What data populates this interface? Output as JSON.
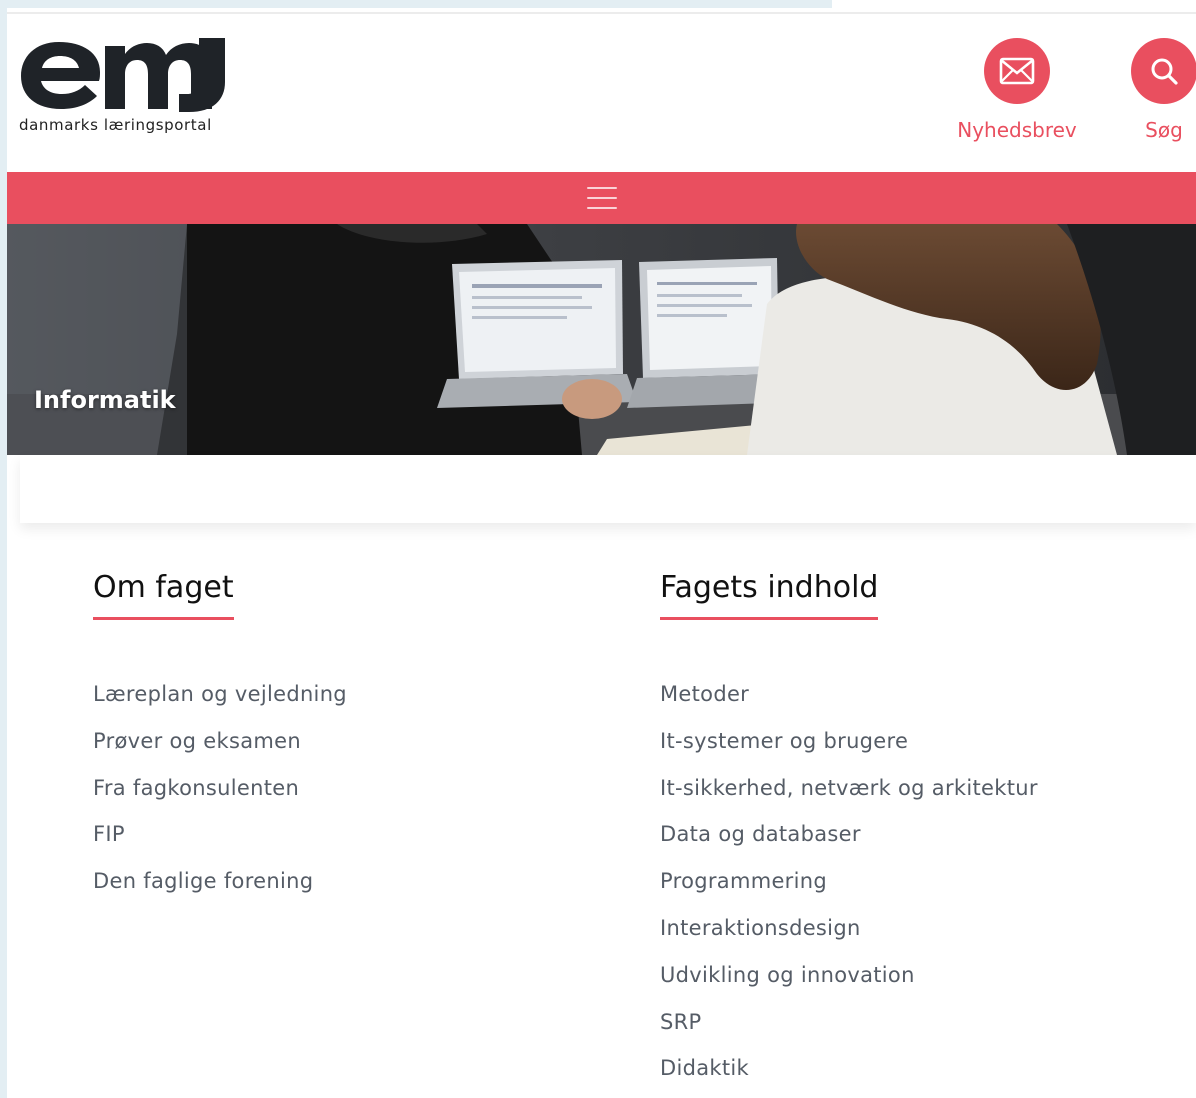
{
  "header": {
    "logo_tagline": "danmarks læringsportal",
    "newsletter_label": "Nyhedsbrev",
    "search_label": "Søg"
  },
  "hero": {
    "title": "Informatik"
  },
  "om_faget": {
    "heading": "Om faget",
    "links": [
      "Læreplan og vejledning",
      "Prøver og eksamen",
      "Fra fagkonsulenten",
      "FIP",
      "Den faglige forening"
    ]
  },
  "fagets_indhold": {
    "heading": "Fagets indhold",
    "links": [
      "Metoder",
      "It-systemer og brugere",
      "It-sikkerhed, netværk og arkitektur",
      "Data og databaser",
      "Programmering",
      "Interaktionsdesign",
      "Udvikling og innovation",
      "SRP",
      "Didaktik"
    ]
  },
  "colors": {
    "accent": "#e94f5f",
    "logo": "#1f2328",
    "link_text": "#555c66"
  }
}
